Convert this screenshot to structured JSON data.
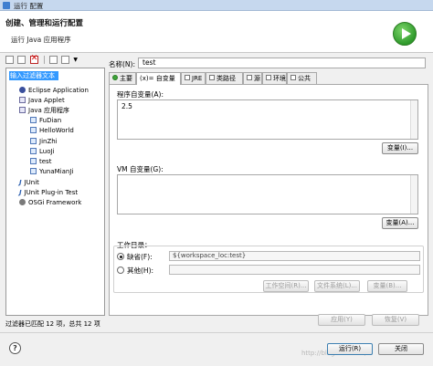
{
  "window": {
    "title": "运行 配置"
  },
  "header": {
    "title": "创建、管理和运行配置",
    "subtitle": "运行 Java 应用程序",
    "run_icon": "run-icon",
    "accent": "#2f9a2c"
  },
  "left": {
    "toolbar": [
      "new-config-icon",
      "duplicate-icon",
      "delete-icon",
      "collapse-all-icon",
      "filter-icon"
    ],
    "filter_placeholder": "输入过滤器文本",
    "tree": [
      {
        "label": "Eclipse Application",
        "icon": "eclipse-icon",
        "level": 1
      },
      {
        "label": "Java Applet",
        "icon": "java-applet-icon",
        "level": 1
      },
      {
        "label": "Java 应用程序",
        "icon": "java-app-icon",
        "level": 1
      },
      {
        "label": "FuDian",
        "icon": "java-class-icon",
        "level": 2
      },
      {
        "label": "HelloWorld",
        "icon": "java-class-icon",
        "level": 2
      },
      {
        "label": "JinZhi",
        "icon": "java-class-icon",
        "level": 2
      },
      {
        "label": "LuoJi",
        "icon": "java-class-icon",
        "level": 2
      },
      {
        "label": "test",
        "icon": "java-class-icon",
        "level": 2
      },
      {
        "label": "YunaMianJi",
        "icon": "java-class-icon",
        "level": 2
      },
      {
        "label": "JUnit",
        "icon": "junit-icon",
        "level": 1
      },
      {
        "label": "JUnit Plug-in Test",
        "icon": "junit-plugin-icon",
        "level": 1
      },
      {
        "label": "OSGi Framework",
        "icon": "osgi-icon",
        "level": 1
      }
    ],
    "status": "过滤器已匹配 12 项，总共 12 项"
  },
  "config": {
    "name_label": "名称(N):",
    "name_value": "test",
    "tabs": [
      "主要",
      "(x)= 自变量",
      "JRE",
      "类路径",
      "源",
      "环境",
      "公共"
    ],
    "program_args_label": "程序自变量(A):",
    "program_args_value": "2.5",
    "variables_button": "变量(I)...",
    "vm_args_label": "VM 自变量(G):",
    "vm_args_value": "",
    "vm_variables_button": "变量(A)...",
    "workdir_label": "工作目录：",
    "default_radio": "缺省(F):",
    "default_value": "${workspace_loc:test}",
    "other_radio": "其他(H):",
    "other_value": "",
    "workspace_button": "工作空间(R)...",
    "filesystem_button": "文件系统(L)...",
    "vars_button": "变量(B)..."
  },
  "actions": {
    "apply": "应用(Y)",
    "revert": "恢复(V)",
    "run": "运行(R)",
    "close": "关闭"
  },
  "help_label": "?",
  "watermark": "http://blog.csdn.net/..."
}
